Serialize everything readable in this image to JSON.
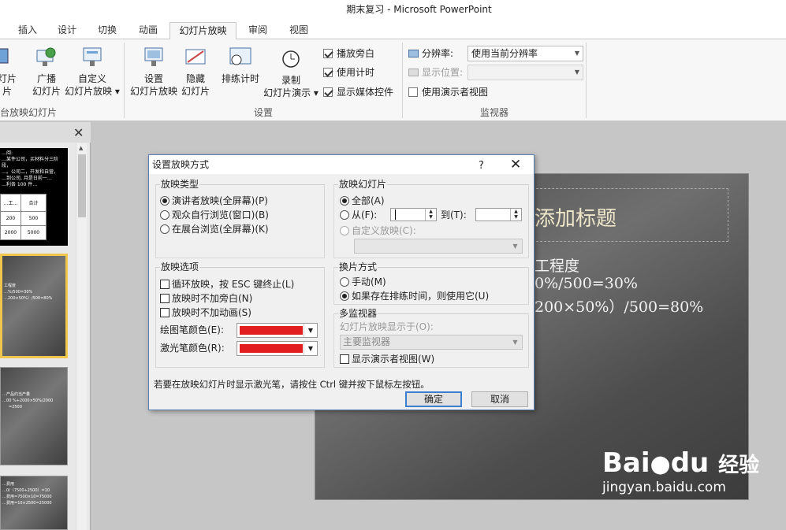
{
  "window": {
    "title": "期末复习 - Microsoft PowerPoint"
  },
  "tabs": [
    "插入",
    "设计",
    "切换",
    "动画",
    "幻灯片放映",
    "审阅",
    "视图"
  ],
  "ribbon": {
    "start_group": {
      "btn_partial": "灯片",
      "btn_partial2": "片",
      "label": "台放映幻灯片"
    },
    "broadcast": [
      "广播",
      "幻灯片"
    ],
    "custom": [
      "自定义",
      "幻灯片放映 ▾"
    ],
    "setup_group": {
      "setup": [
        "设置",
        "幻灯片放映"
      ],
      "hide": [
        "隐藏",
        "幻灯片"
      ],
      "rehearse": "排练计时",
      "record": [
        "录制",
        "幻灯片演示 ▾"
      ],
      "chk_narration": "播放旁白",
      "chk_timing": "使用计时",
      "chk_media": "显示媒体控件",
      "label": "设置"
    },
    "monitor_group": {
      "resolution_label": "分辨率:",
      "resolution_value": "使用当前分辨率",
      "showon_label": "显示位置:",
      "presenter_view": "使用演示者视图",
      "label": "监视器"
    }
  },
  "slides_pane": {
    "thumb1": [
      "…阅:",
      "…某件公司，买材料分三阶段，",
      "…。公司二，开发和自营，",
      "…到公司, 月是日前一…",
      "…利各 100 件…"
    ],
    "thumb1_table": [
      [
        "…工…",
        "合计"
      ],
      [
        "200",
        "500"
      ],
      [
        "2000",
        "5000"
      ]
    ],
    "thumb2": [
      "工程度",
      "…%/500=30%",
      "…200×50%）/500=80%"
    ],
    "thumb3": [
      "…产品约当产量",
      "…00 %+2000×50%/2000",
      "=2500"
    ],
    "thumb4": [
      "…费用",
      "…0/（7500+2500）=10",
      "…费用=7500×10=75000",
      "…费用=10×2500=25000"
    ]
  },
  "slide": {
    "title": "添加标题",
    "lines": [
      "工程度",
      "0%/500=30%",
      "200×50%）/500=80%"
    ]
  },
  "watermark": {
    "brand": "Bai",
    "brand2": "du",
    "jingyan": "经验",
    "url": "jingyan.baidu.com"
  },
  "dialog": {
    "title": "设置放映方式",
    "help": "?",
    "show_type": {
      "label": "放映类型",
      "options": [
        "演讲者放映(全屏幕)(P)",
        "观众自行浏览(窗口)(B)",
        "在展台浏览(全屏幕)(K)"
      ]
    },
    "show_slides": {
      "label": "放映幻灯片",
      "all": "全部(A)",
      "from": "从(F):",
      "to": "到(T):",
      "custom": "自定义放映(C):"
    },
    "show_options": {
      "label": "放映选项",
      "loop": "循环放映，按 ESC 键终止(L)",
      "no_narration": "放映时不加旁白(N)",
      "no_animation": "放映时不加动画(S)",
      "pen_color": "绘图笔颜色(E):",
      "laser_color": "激光笔颜色(R):"
    },
    "advance": {
      "label": "换片方式",
      "manual": "手动(M)",
      "timings": "如果存在排练时间，则使用它(U)"
    },
    "multi_monitor": {
      "label": "多监视器",
      "display_on": "幻灯片放映显示于(O):",
      "monitor_value": "主要监视器",
      "presenter": "显示演示者视图(W)"
    },
    "hint": "若要在放映幻灯片时显示激光笔，请按住 Ctrl 键并按下鼠标左按钮。",
    "ok": "确定",
    "cancel": "取消"
  },
  "colors": {
    "pen": "#e31e1e",
    "laser": "#e31e1e",
    "accent": "#3c7fd0"
  }
}
